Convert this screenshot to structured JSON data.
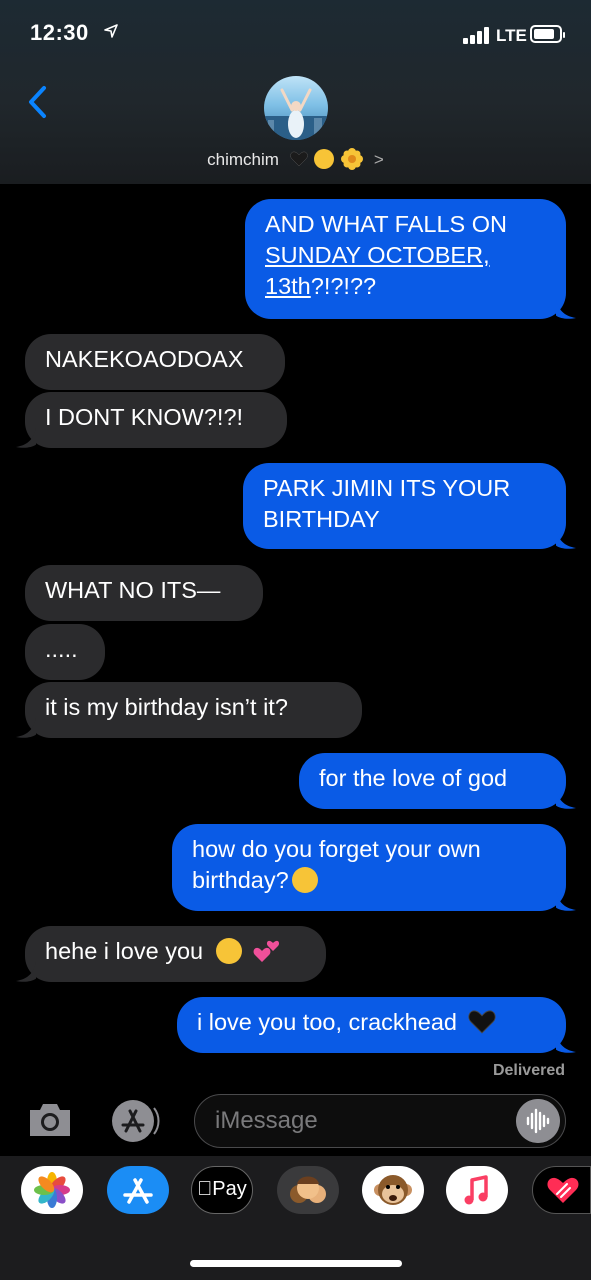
{
  "status_bar": {
    "time": "12:30",
    "network": "LTE"
  },
  "contact": {
    "name": "chimchim",
    "chevron": ">"
  },
  "messages": [
    {
      "from": "me",
      "lines": [
        "AND WHAT FALLS ON",
        "SUNDAY OCTOBER,",
        "13th?!?!??"
      ]
    },
    {
      "from": "them",
      "text": "NAKEKOAODOAX"
    },
    {
      "from": "them",
      "text": "I DONT KNOW?!?!"
    },
    {
      "from": "me",
      "lines": [
        "PARK JIMIN ITS YOUR",
        "BIRTHDAY"
      ]
    },
    {
      "from": "them",
      "text": "WHAT NO ITS—"
    },
    {
      "from": "them",
      "text": "....."
    },
    {
      "from": "them",
      "text": "it is my birthday isn’t it?"
    },
    {
      "from": "me",
      "text": "for the love of god"
    },
    {
      "from": "me",
      "lines": [
        "how do you forget your own",
        "birthday?"
      ]
    },
    {
      "from": "them",
      "text": "hehe i love you"
    },
    {
      "from": "me",
      "text": "i love you too, crackhead"
    }
  ],
  "delivered_label": "Delivered",
  "input": {
    "placeholder": "iMessage"
  },
  "apps": [
    "photos-icon",
    "app-store-icon",
    "apple-pay-icon",
    "memoji-icon",
    "animoji-icon",
    "music-icon",
    "digital-touch-icon"
  ],
  "apple_pay_label": "Pay",
  "colors": {
    "sent": "#0a5be6",
    "received": "#2b2b2d",
    "accent": "#0a84ff"
  }
}
